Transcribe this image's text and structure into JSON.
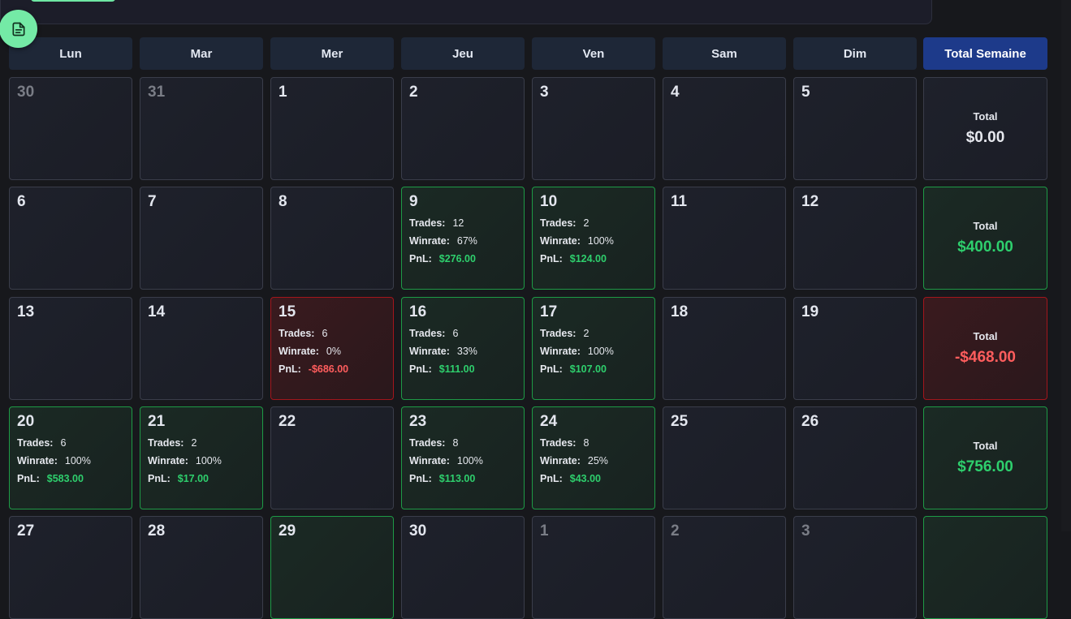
{
  "headers": [
    "Lun",
    "Mar",
    "Mer",
    "Jeu",
    "Ven",
    "Sam",
    "Dim",
    "Total Semaine"
  ],
  "labels": {
    "trades": "Trades:",
    "winrate": "Winrate:",
    "pnl": "PnL:",
    "total": "Total"
  },
  "colors": {
    "profit": "#2ecf6d",
    "loss": "#ff5d5d",
    "accent": "#1d3a8a",
    "fab": "#74eaa6"
  },
  "fab_icon": "document-icon",
  "weeks": [
    {
      "days": [
        {
          "day": "30",
          "muted": true
        },
        {
          "day": "31",
          "muted": true
        },
        {
          "day": "1"
        },
        {
          "day": "2"
        },
        {
          "day": "3"
        },
        {
          "day": "4"
        },
        {
          "day": "5"
        }
      ],
      "total": {
        "value": "$0.00",
        "status": "neutral"
      }
    },
    {
      "days": [
        {
          "day": "6"
        },
        {
          "day": "7"
        },
        {
          "day": "8"
        },
        {
          "day": "9",
          "status": "profit",
          "trades": "12",
          "winrate": "67%",
          "pnl": "$276.00"
        },
        {
          "day": "10",
          "status": "profit",
          "trades": "2",
          "winrate": "100%",
          "pnl": "$124.00"
        },
        {
          "day": "11"
        },
        {
          "day": "12"
        }
      ],
      "total": {
        "value": "$400.00",
        "status": "profit"
      }
    },
    {
      "days": [
        {
          "day": "13"
        },
        {
          "day": "14"
        },
        {
          "day": "15",
          "status": "loss",
          "trades": "6",
          "winrate": "0%",
          "pnl": "-$686.00"
        },
        {
          "day": "16",
          "status": "profit",
          "trades": "6",
          "winrate": "33%",
          "pnl": "$111.00"
        },
        {
          "day": "17",
          "status": "profit",
          "trades": "2",
          "winrate": "100%",
          "pnl": "$107.00"
        },
        {
          "day": "18"
        },
        {
          "day": "19"
        }
      ],
      "total": {
        "value": "-$468.00",
        "status": "loss"
      }
    },
    {
      "days": [
        {
          "day": "20",
          "status": "profit",
          "trades": "6",
          "winrate": "100%",
          "pnl": "$583.00"
        },
        {
          "day": "21",
          "status": "profit",
          "trades": "2",
          "winrate": "100%",
          "pnl": "$17.00"
        },
        {
          "day": "22"
        },
        {
          "day": "23",
          "status": "profit",
          "trades": "8",
          "winrate": "100%",
          "pnl": "$113.00"
        },
        {
          "day": "24",
          "status": "profit",
          "trades": "8",
          "winrate": "25%",
          "pnl": "$43.00"
        },
        {
          "day": "25"
        },
        {
          "day": "26"
        }
      ],
      "total": {
        "value": "$756.00",
        "status": "profit"
      }
    },
    {
      "days": [
        {
          "day": "27"
        },
        {
          "day": "28"
        },
        {
          "day": "29",
          "status": "profit"
        },
        {
          "day": "30"
        },
        {
          "day": "1",
          "muted": true
        },
        {
          "day": "2",
          "muted": true
        },
        {
          "day": "3",
          "muted": true
        }
      ],
      "total": {
        "value": "",
        "status": "profit"
      }
    }
  ]
}
